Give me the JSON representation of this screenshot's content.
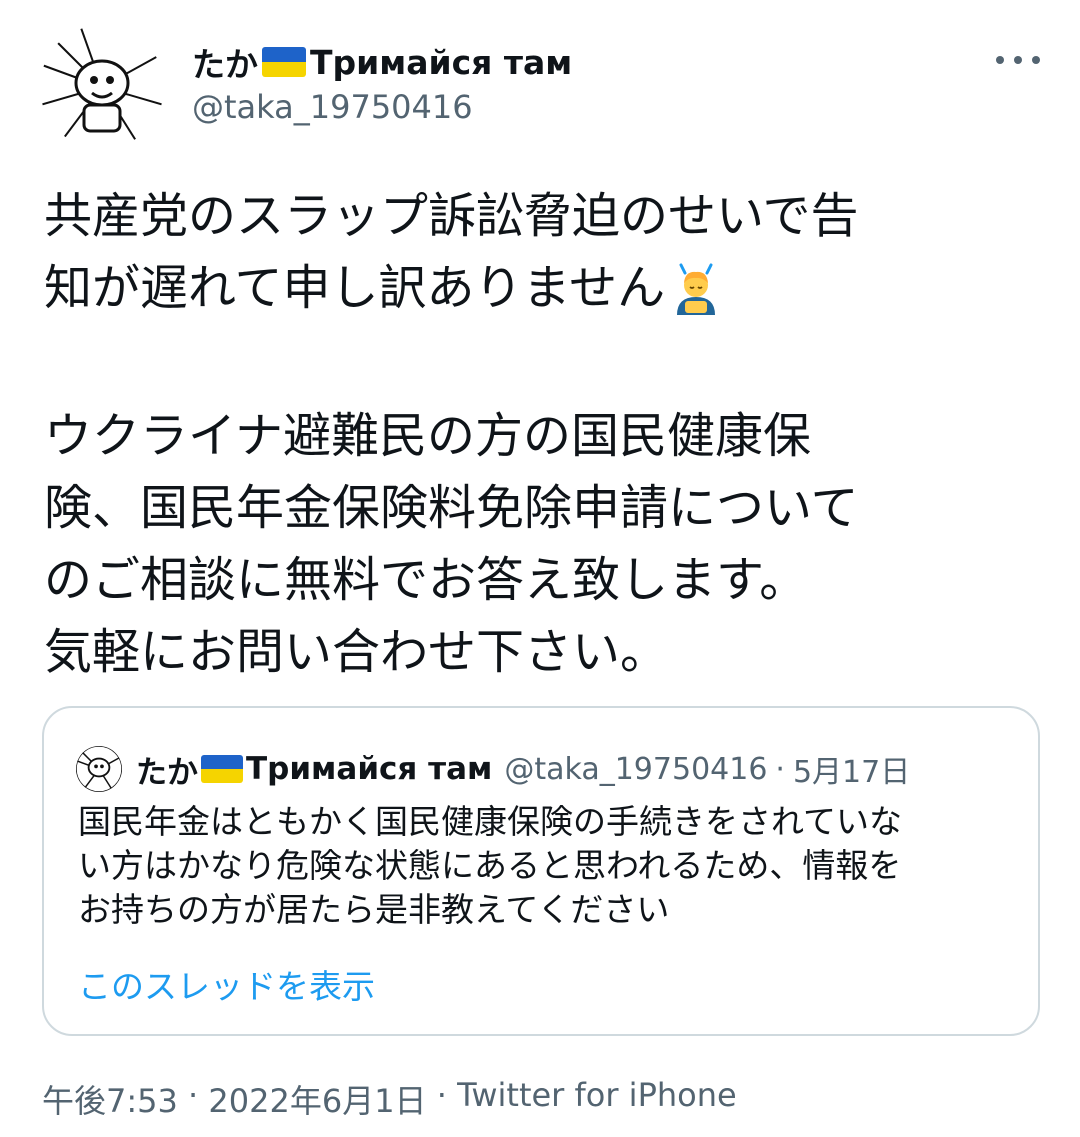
{
  "author": {
    "name_prefix": "たか",
    "name_suffix": "Тримайся там",
    "handle": "@taka_19750416",
    "avatar_icon": "manga-avatar-icon",
    "flag_icon": "ukraine-flag-icon"
  },
  "menu": {
    "more_icon": "more-dots-icon"
  },
  "tweet": {
    "lines": [
      "共産党のスラップ訴訟脅迫のせいで告",
      "知が遅れて申し訳ありません"
    ],
    "emoji": "man-bowing-emoji",
    "lines2": [
      "ウクライナ避難民の方の国民健康保",
      "険、国民年金保険料免除申請について",
      "のご相談に無料でお答え致します。",
      "気軽にお問い合わせ下さい。"
    ]
  },
  "quote": {
    "name_prefix": "たか",
    "name_suffix": "Тримайся там",
    "handle": "@taka_19750416",
    "separator": "·",
    "date": "5月17日",
    "lines": [
      "国民年金はともかく国民健康保険の手続きをされていな",
      "い方はかなり危険な状態にあると思われるため、情報を",
      "お持ちの方が居たら是非教えてください"
    ],
    "show_thread": "このスレッドを表示"
  },
  "footer": {
    "time": "午後7:53",
    "sep1": " · ",
    "date": "2022年6月1日",
    "sep2": " · ",
    "source": "Twitter for iPhone"
  },
  "colors": {
    "text": "#0f1419",
    "secondary": "#536471",
    "link": "#1d9bf0",
    "border": "#cfd9de",
    "flag_blue": "#1e63c9",
    "flag_yellow": "#f5d400"
  }
}
